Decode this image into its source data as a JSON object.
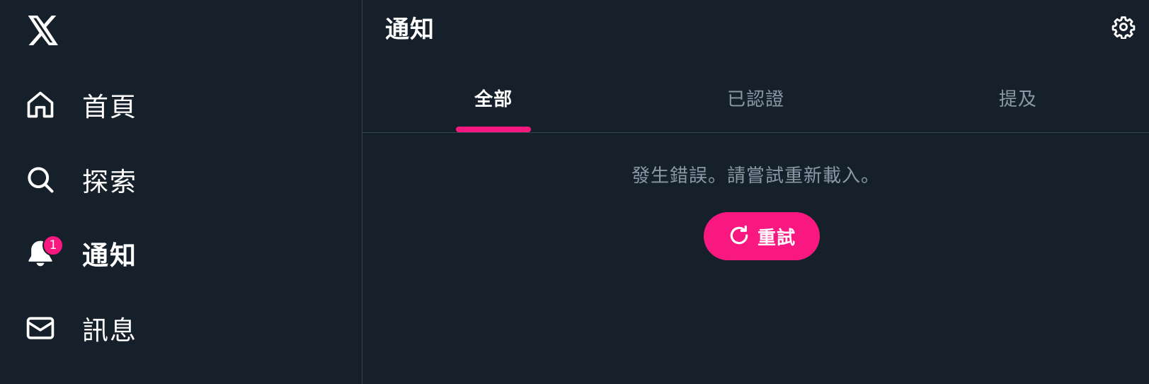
{
  "sidebar": {
    "logo_icon": "x-logo-icon",
    "items": [
      {
        "label": "首頁",
        "icon": "home-icon",
        "active": false
      },
      {
        "label": "探索",
        "icon": "search-icon",
        "active": false
      },
      {
        "label": "通知",
        "icon": "bell-icon",
        "active": true,
        "badge": "1"
      },
      {
        "label": "訊息",
        "icon": "mail-icon",
        "active": false
      }
    ]
  },
  "main": {
    "title": "通知",
    "settings_icon": "gear-icon",
    "tabs": [
      {
        "label": "全部",
        "active": true
      },
      {
        "label": "已認證",
        "active": false
      },
      {
        "label": "提及",
        "active": false
      }
    ],
    "error_message": "發生錯誤。請嘗試重新載入。",
    "retry_label": "重試",
    "retry_icon": "refresh-icon"
  },
  "colors": {
    "background": "#15202b",
    "accent": "#f91880",
    "divider": "#38444d",
    "text_primary": "#ffffff",
    "text_secondary": "#8b98a5"
  }
}
